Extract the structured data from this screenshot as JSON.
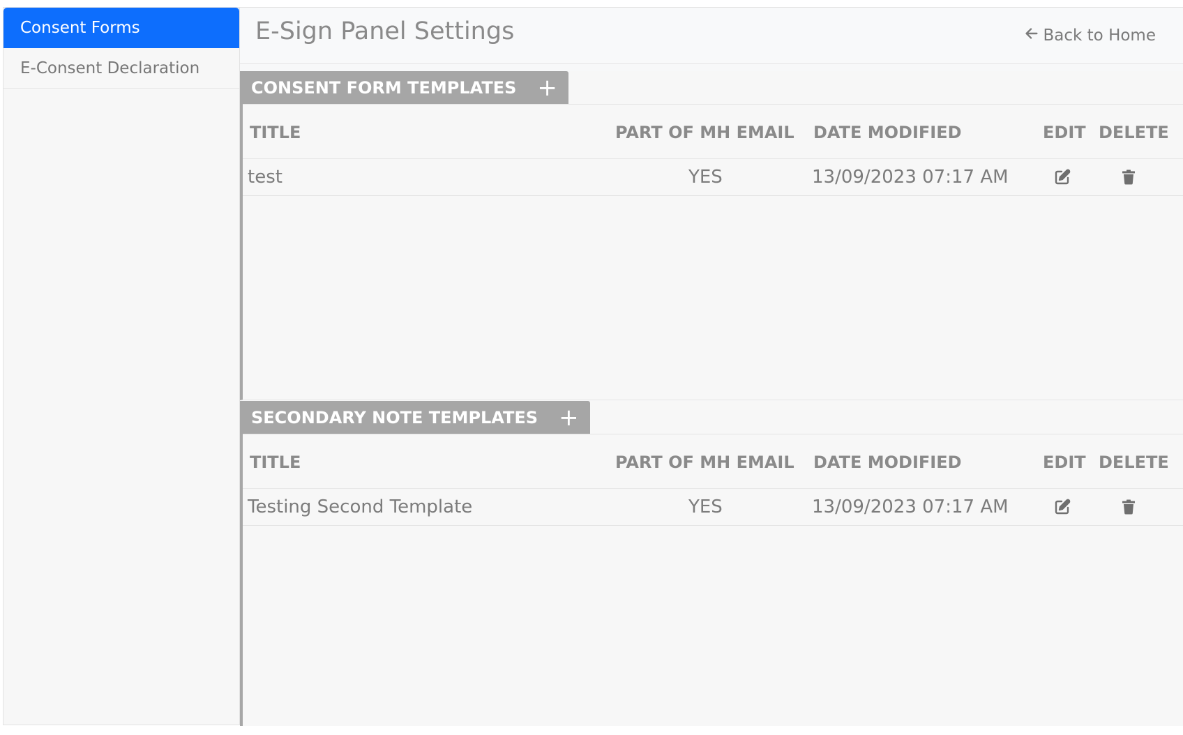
{
  "sidebar": {
    "items": [
      {
        "label": "Consent Forms",
        "active": true
      },
      {
        "label": "E-Consent Declaration",
        "active": false
      }
    ]
  },
  "header": {
    "title": "E-Sign Panel Settings",
    "back_label": "Back to Home",
    "back_icon": "arrow-left-icon"
  },
  "sections": [
    {
      "title": "CONSENT FORM TEMPLATES",
      "add_icon": "plus-icon",
      "columns": [
        "TITLE",
        "PART OF MH EMAIL",
        "DATE MODIFIED",
        "EDIT",
        "DELETE"
      ],
      "rows": [
        {
          "title": "test",
          "mh_email": "YES",
          "date_modified": "13/09/2023 07:17 AM"
        }
      ]
    },
    {
      "title": "SECONDARY NOTE TEMPLATES",
      "add_icon": "plus-icon",
      "columns": [
        "TITLE",
        "PART OF MH EMAIL",
        "DATE MODIFIED",
        "EDIT",
        "DELETE"
      ],
      "rows": [
        {
          "title": "Testing Second Template",
          "mh_email": "YES",
          "date_modified": "13/09/2023 07:17 AM"
        }
      ]
    }
  ],
  "colors": {
    "accent": "#0d6efd",
    "tab_bg": "#a6a6a6",
    "text_muted": "#7c7c7c"
  },
  "row_icons": {
    "edit": "edit-icon",
    "delete": "trash-icon"
  },
  "plus_glyph": "+"
}
